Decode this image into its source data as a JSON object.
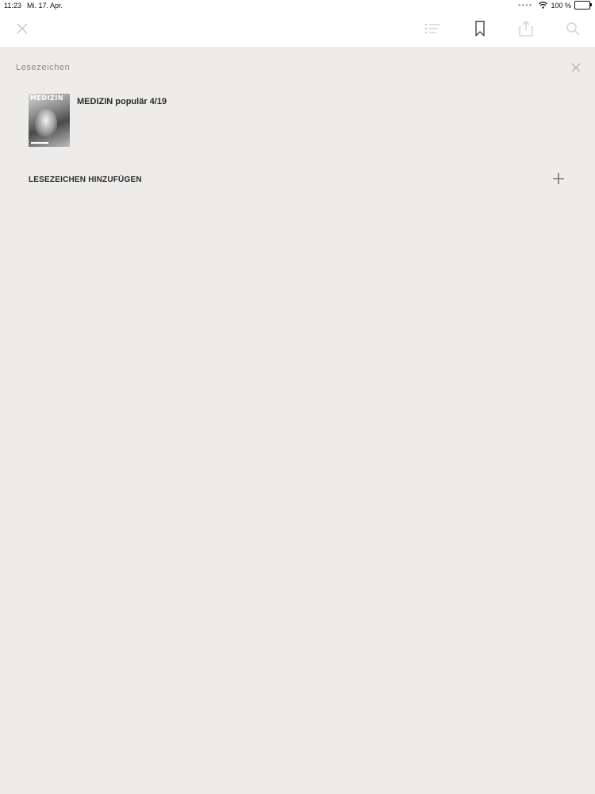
{
  "status_bar": {
    "time": "11:23",
    "date": "Mi. 17. Apr.",
    "battery": "100 %"
  },
  "toolbar": {
    "icons": [
      "close-icon",
      "table-of-contents-icon",
      "bookmark-icon",
      "share-icon",
      "search-icon"
    ]
  },
  "panel": {
    "title": "Lesezeichen",
    "bookmarks": [
      {
        "title": "MEDIZIN populär 4/19",
        "cover_masthead": "MEDIZIN"
      }
    ],
    "add_label": "LESEZEICHEN HINZUFÜGEN"
  },
  "colors": {
    "background": "#edecea",
    "toolbar": "#ffffff",
    "text_dark": "#2b2b2b",
    "title_gray": "#8a8a8a"
  }
}
